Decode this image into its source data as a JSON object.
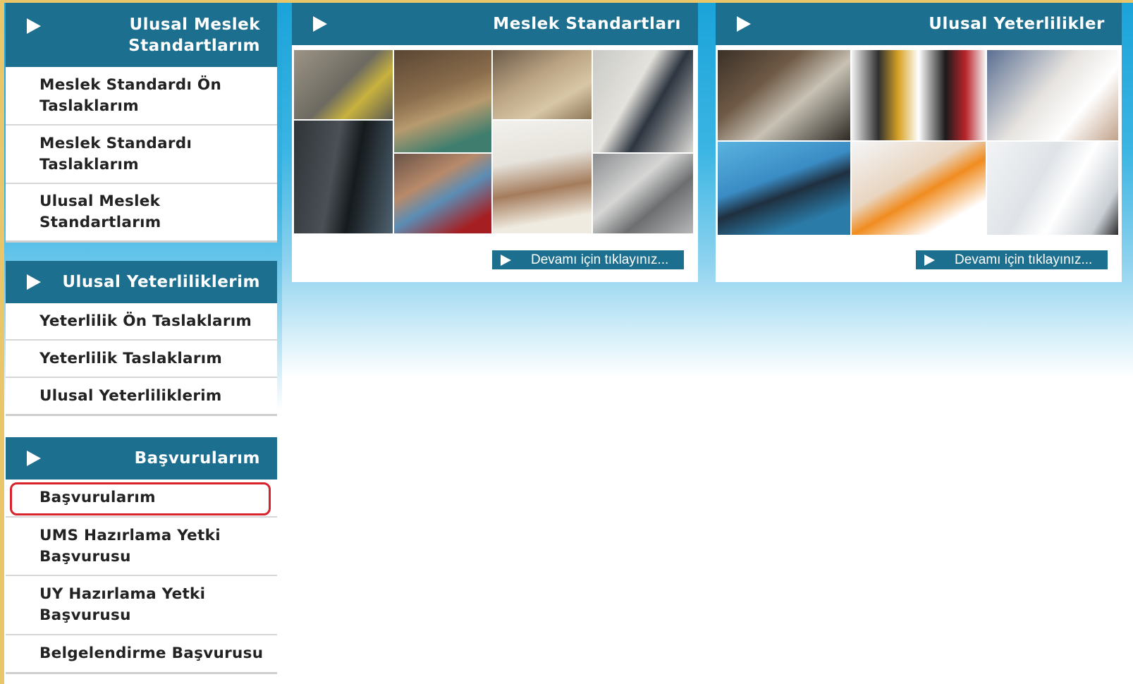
{
  "sidebar": {
    "standards": {
      "title_line1": "Ulusal Meslek",
      "title_line2": "Standartlarım",
      "items": [
        {
          "line1": "Meslek Standardı Ön",
          "line2": "Taslaklarım"
        },
        {
          "line1": "Meslek Standardı",
          "line2": "Taslaklarım"
        },
        {
          "line1": "Ulusal Meslek",
          "line2": "Standartlarım"
        }
      ]
    },
    "qualifications": {
      "title": "Ulusal Yeterliliklerim",
      "items": [
        "Yeterlilik Ön Taslaklarım",
        "Yeterlilik Taslaklarım",
        "Ulusal Yeterliliklerim"
      ]
    },
    "applications": {
      "title": "Başvurularım",
      "items": [
        {
          "line1": "Başvurularım",
          "line2": ""
        },
        {
          "line1": "UMS Hazırlama Yetki",
          "line2": "Başvurusu"
        },
        {
          "line1": "UY Hazırlama Yetki",
          "line2": "Başvurusu"
        },
        {
          "line1": "Belgelendirme Başvurusu",
          "line2": ""
        }
      ],
      "highlighted_index": 0
    }
  },
  "panels": {
    "meslek": {
      "title": "Meslek Standartları",
      "more_label": "Devamı için tıklayınız..."
    },
    "yeterlilik": {
      "title": "Ulusal Yeterlilikler",
      "more_label": "Devamı için tıklayınız..."
    }
  },
  "colors": {
    "header_bg": "#1c6f8e",
    "highlight_border": "#d8222b",
    "page_gradient_top": "#1aa3d9"
  },
  "icons": {
    "arrow": "play-triangle-icon"
  }
}
